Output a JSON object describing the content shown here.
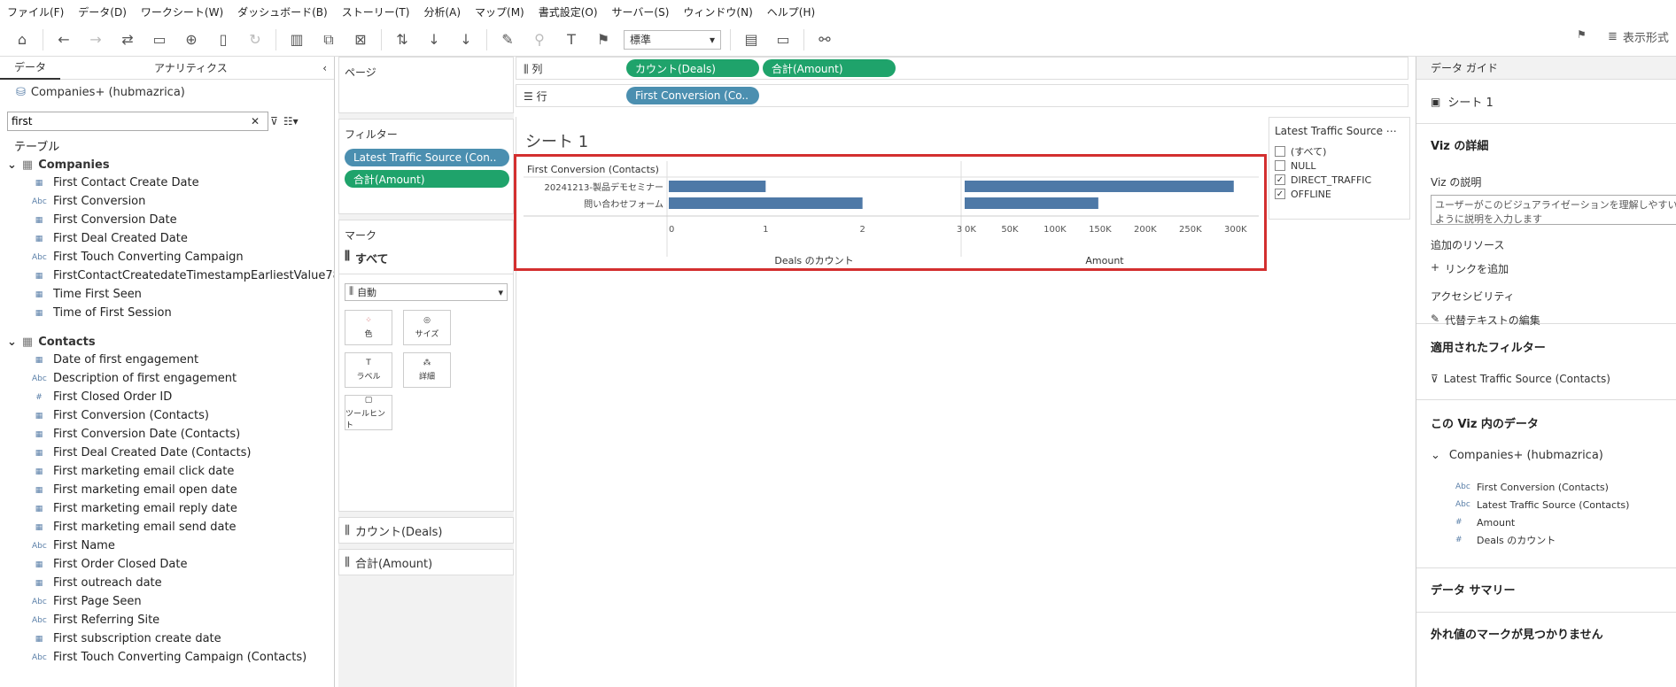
{
  "menu": [
    "ファイル(F)",
    "データ(D)",
    "ワークシート(W)",
    "ダッシュボード(B)",
    "ストーリー(T)",
    "分析(A)",
    "マップ(M)",
    "書式設定(O)",
    "サーバー(S)",
    "ウィンドウ(N)",
    "ヘルプ(H)"
  ],
  "toolbar": {
    "fit_select": "標準",
    "show_me": "表示形式"
  },
  "left": {
    "tab_data": "データ",
    "tab_analytics": "アナリティクス",
    "datasource": "Companies+ (hubmazrica)",
    "search_value": "first",
    "tables_label": "テーブル",
    "companies": {
      "name": "Companies",
      "fields": [
        {
          "type": "date",
          "name": "First Contact Create Date"
        },
        {
          "type": "abc",
          "name": "First Conversion"
        },
        {
          "type": "date",
          "name": "First Conversion Date"
        },
        {
          "type": "date",
          "name": "First Deal Created Date"
        },
        {
          "type": "abc",
          "name": "First Touch Converting Campaign"
        },
        {
          "type": "date",
          "name": "FirstContactCreatedateTimestampEarliestValue78⋯"
        },
        {
          "type": "date",
          "name": "Time First Seen"
        },
        {
          "type": "date",
          "name": "Time of First Session"
        }
      ]
    },
    "contacts": {
      "name": "Contacts",
      "fields": [
        {
          "type": "date",
          "name": "Date of first engagement"
        },
        {
          "type": "abc",
          "name": "Description of first engagement"
        },
        {
          "type": "num",
          "name": "First Closed Order ID"
        },
        {
          "type": "date",
          "name": "First Conversion (Contacts)"
        },
        {
          "type": "date",
          "name": "First Conversion Date (Contacts)"
        },
        {
          "type": "date",
          "name": "First Deal Created Date (Contacts)"
        },
        {
          "type": "date",
          "name": "First marketing email click date"
        },
        {
          "type": "date",
          "name": "First marketing email open date"
        },
        {
          "type": "date",
          "name": "First marketing email reply date"
        },
        {
          "type": "date",
          "name": "First marketing email send date"
        },
        {
          "type": "abc",
          "name": "First Name"
        },
        {
          "type": "date",
          "name": "First Order Closed Date"
        },
        {
          "type": "date",
          "name": "First outreach date"
        },
        {
          "type": "abc",
          "name": "First Page Seen"
        },
        {
          "type": "abc",
          "name": "First Referring Site"
        },
        {
          "type": "date",
          "name": "First subscription create date"
        },
        {
          "type": "abc",
          "name": "First Touch Converting Campaign (Contacts)"
        }
      ]
    }
  },
  "mid": {
    "pages": "ページ",
    "filters": "フィルター",
    "filter_pills": [
      "Latest Traffic Source (Con..",
      "合計(Amount)"
    ],
    "marks": "マーク",
    "marks_all": "すべて",
    "mark_type": "自動",
    "mark_buttons": [
      "色",
      "サイズ",
      "ラベル",
      "詳細",
      "ツールヒント"
    ],
    "mark_cards": [
      "カウント(Deals)",
      "合計(Amount)"
    ]
  },
  "shelves": {
    "columns_label": "列",
    "rows_label": "行",
    "column_pills": [
      "カウント(Deals)",
      "合計(Amount)"
    ],
    "row_pills": [
      "First Conversion (Co.."
    ]
  },
  "sheet_title": "シート 1",
  "chart_data": [
    {
      "type": "bar",
      "row_header": "First Conversion (Contacts)",
      "categories": [
        "20241213-製品デモセミナー",
        "問い合わせフォーム"
      ],
      "values": [
        1,
        2
      ],
      "xlabel": "Deals のカウント",
      "xlim": [
        0,
        3
      ],
      "ticks": [
        "0",
        "1",
        "2",
        "3"
      ],
      "bar_color": "#4e79a7"
    },
    {
      "type": "bar",
      "categories": [
        "20241213-製品デモセミナー",
        "問い合わせフォーム"
      ],
      "values": [
        298000,
        148000
      ],
      "xlabel": "Amount",
      "xlim": [
        0,
        310000
      ],
      "ticks": [
        "0K",
        "50K",
        "100K",
        "150K",
        "200K",
        "250K",
        "300K"
      ],
      "bar_color": "#4e79a7"
    }
  ],
  "legend": {
    "title": "Latest Traffic Source ⋯",
    "items": [
      {
        "label": "(すべて)",
        "checked": false
      },
      {
        "label": "NULL",
        "checked": false
      },
      {
        "label": "DIRECT_TRAFFIC",
        "checked": true
      },
      {
        "label": "OFFLINE",
        "checked": true
      }
    ]
  },
  "right": {
    "title": "データ ガイド",
    "sheet": "シート 1",
    "viz_detail": "Viz の詳細",
    "viz_desc_label": "Viz の説明",
    "viz_desc_placeholder": "ユーザーがこのビジュアライゼーションを理解しやすいように説明を入力します",
    "resources_label": "追加のリソース",
    "add_link": "リンクを追加",
    "accessibility": "アクセシビリティ",
    "alt_text": "代替テキストの編集",
    "applied_filters": "適用されたフィルター",
    "filter_item": "Latest Traffic Source (Contacts)",
    "data_in_viz": "この Viz 内のデータ",
    "datasource": "Companies+ (hubmazrica)",
    "fields": [
      {
        "type": "abc",
        "name": "First Conversion (Contacts)"
      },
      {
        "type": "abc",
        "name": "Latest Traffic Source (Contacts)"
      },
      {
        "type": "num",
        "name": "Amount"
      },
      {
        "type": "num",
        "name": "Deals のカウント"
      }
    ],
    "data_summary": "データ サマリー",
    "outliers": "外れ値のマークが見つかりません"
  },
  "colors": {
    "bar": "#4e79a7",
    "pill_blue": "#4b8fb0",
    "pill_green": "#1fa36b",
    "highlight": "#d32f2f"
  }
}
